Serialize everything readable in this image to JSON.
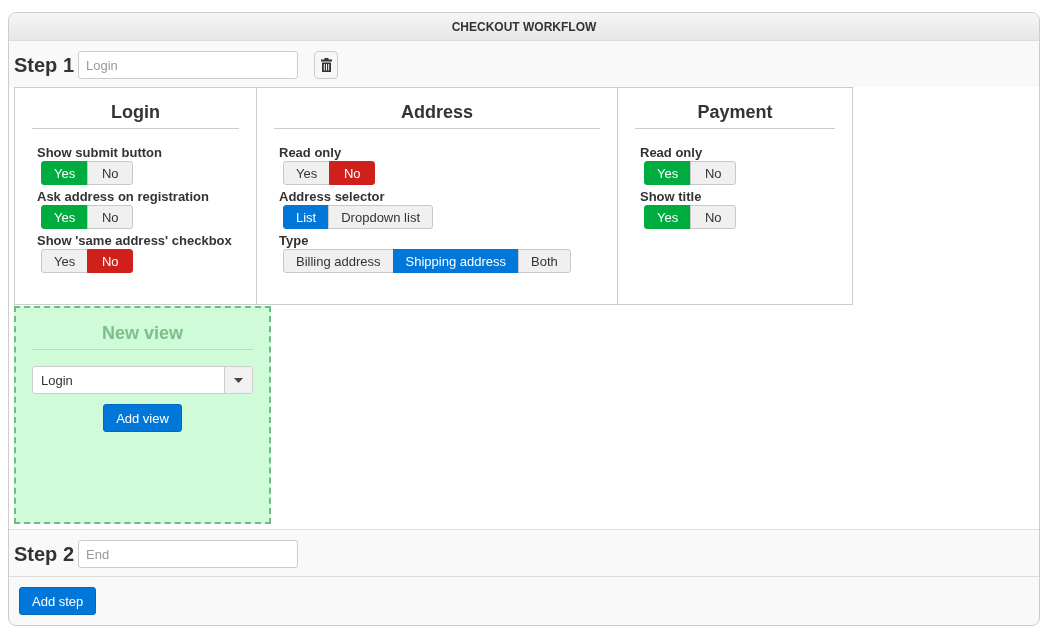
{
  "title": "CHECKOUT WORKFLOW",
  "steps": [
    {
      "label": "Step 1",
      "placeholder": "Login",
      "deletable": true,
      "views": [
        {
          "title": "Login",
          "settings": [
            {
              "label": "Show submit button",
              "options": [
                {
                  "label": "Yes",
                  "kind": "yes",
                  "selected": true
                },
                {
                  "label": "No",
                  "kind": "no",
                  "selected": false
                }
              ]
            },
            {
              "label": "Ask address on registration",
              "options": [
                {
                  "label": "Yes",
                  "kind": "yes",
                  "selected": true
                },
                {
                  "label": "No",
                  "kind": "no",
                  "selected": false
                }
              ]
            },
            {
              "label": "Show 'same address' checkbox",
              "options": [
                {
                  "label": "Yes",
                  "kind": "yes",
                  "selected": false
                },
                {
                  "label": "No",
                  "kind": "no",
                  "selected": true
                }
              ]
            }
          ]
        },
        {
          "title": "Address",
          "settings": [
            {
              "label": "Read only",
              "options": [
                {
                  "label": "Yes",
                  "kind": "yes",
                  "selected": false
                },
                {
                  "label": "No",
                  "kind": "no",
                  "selected": true
                }
              ]
            },
            {
              "label": "Address selector",
              "options": [
                {
                  "label": "List",
                  "kind": "choice",
                  "selected": true
                },
                {
                  "label": "Dropdown list",
                  "kind": "choice",
                  "selected": false
                }
              ]
            },
            {
              "label": "Type",
              "options": [
                {
                  "label": "Billing address",
                  "kind": "choice",
                  "selected": false
                },
                {
                  "label": "Shipping address",
                  "kind": "choice",
                  "selected": true
                },
                {
                  "label": "Both",
                  "kind": "choice",
                  "selected": false
                }
              ]
            }
          ]
        },
        {
          "title": "Payment",
          "settings": [
            {
              "label": "Read only",
              "options": [
                {
                  "label": "Yes",
                  "kind": "yes",
                  "selected": true
                },
                {
                  "label": "No",
                  "kind": "no",
                  "selected": false
                }
              ]
            },
            {
              "label": "Show title",
              "options": [
                {
                  "label": "Yes",
                  "kind": "yes",
                  "selected": true
                },
                {
                  "label": "No",
                  "kind": "no",
                  "selected": false
                }
              ]
            }
          ]
        }
      ],
      "new_view": {
        "title": "New view",
        "value": "Login",
        "button": "Add view"
      }
    },
    {
      "label": "Step 2",
      "placeholder": "End",
      "deletable": false
    }
  ],
  "add_step": "Add step"
}
